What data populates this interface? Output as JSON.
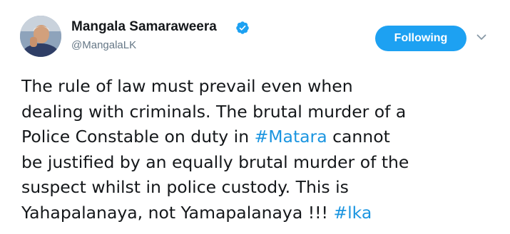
{
  "author": {
    "name": "Mangala Samaraweera",
    "handle": "@MangalaLK",
    "verified": true
  },
  "follow_button": {
    "label": "Following"
  },
  "tweet": {
    "lines": [
      [
        "The rule of law must prevail even when"
      ],
      [
        "dealing with criminals. The brutal murder of a"
      ],
      [
        "Police Constable on duty in ",
        "#Matara",
        " cannot"
      ],
      [
        "be justified by an equally brutal murder of the"
      ],
      [
        "suspect whilst in police custody. This is"
      ],
      [
        "Yahapalanaya, not Yamapalanaya !!! ",
        "#lka"
      ]
    ]
  },
  "icons": {
    "verified": "verified-badge-icon",
    "menu": "chevron-down-icon"
  },
  "colors": {
    "accent": "#1da1f2",
    "hashtag": "#1b95e0",
    "text": "#14171a",
    "muted": "#657786"
  }
}
